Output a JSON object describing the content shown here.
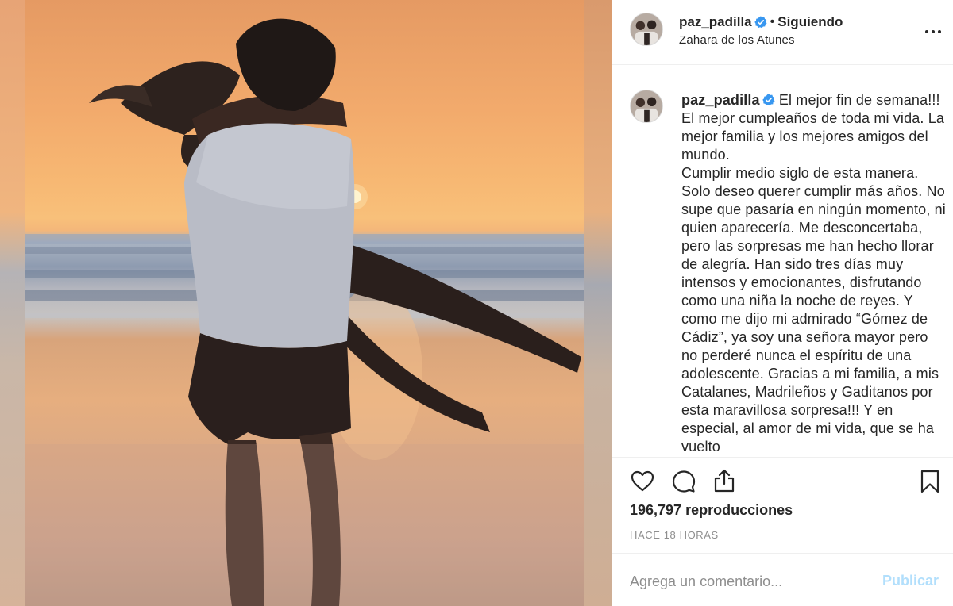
{
  "post": {
    "username": "paz_padilla",
    "follow_status": "Siguiendo",
    "separator": "•",
    "location": "Zahara de los Atunes"
  },
  "caption": {
    "username": "paz_padilla",
    "text": "El mejor fin de semana!!! El mejor cumpleaños de toda mi vida. La mejor familia y los mejores amigos del mundo.\nCumplir medio siglo de esta manera. Solo deseo querer cumplir más años. No supe que pasaría en ningún momento, ni quien aparecería. Me desconcertaba, pero las sorpresas me han hecho llorar de alegría. Han sido tres días muy intensos y emocionantes, disfrutando como una niña la noche de reyes. Y como me dijo mi admirado “Gómez de Cádiz”, ya soy una señora mayor pero no perderé nunca el espíritu de una adolescente. Gracias a mi familia, a mis Catalanes, Madrileños y Gaditanos por esta maravillosa sorpresa!!! Y en especial, al amor de mi vida, que se ha vuelto"
  },
  "stats": {
    "views": "196,797 reproducciones",
    "posted": "HACE 18 HORAS"
  },
  "comment": {
    "placeholder": "Agrega un comentario...",
    "submit_label": "Publicar"
  },
  "icons": {
    "verified": "verified-badge-icon",
    "more": "more-options-icon",
    "like": "heart-icon",
    "comment": "comment-bubble-icon",
    "share": "share-icon",
    "save": "bookmark-icon"
  },
  "colors": {
    "verified_blue": "#3897f0",
    "text": "#262626",
    "muted": "#8e8e8e",
    "post_disabled": "#b2dffc",
    "border": "#efefef"
  }
}
